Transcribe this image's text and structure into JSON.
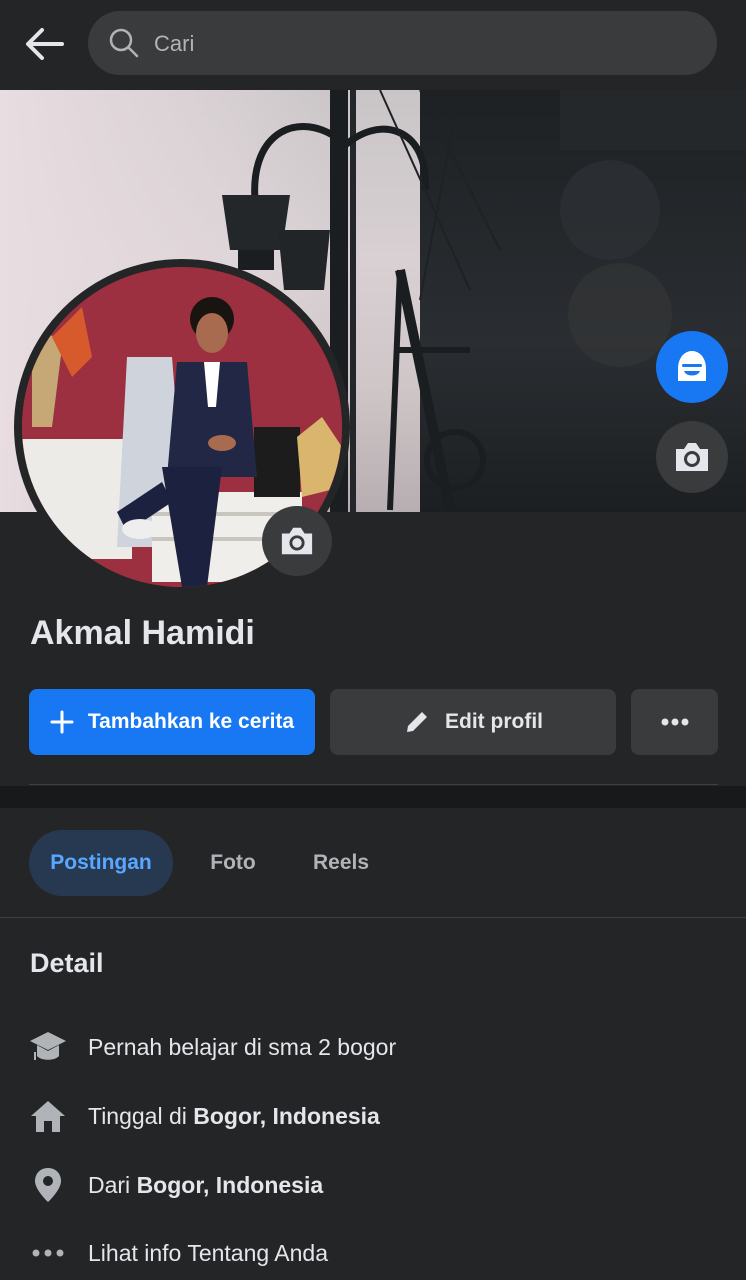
{
  "search": {
    "placeholder": "Cari"
  },
  "profile": {
    "name": "Akmal Hamidi"
  },
  "actions": {
    "add_story_label": "Tambahkan ke cerita",
    "edit_profile_label": "Edit profil"
  },
  "tabs": [
    {
      "label": "Postingan",
      "active": true
    },
    {
      "label": "Foto",
      "active": false
    },
    {
      "label": "Reels",
      "active": false
    }
  ],
  "detail": {
    "title": "Detail",
    "items": [
      {
        "icon": "education-icon",
        "prefix": "Pernah belajar di sma 2 bogor",
        "bold": ""
      },
      {
        "icon": "home-icon",
        "prefix": "Tinggal di ",
        "bold": "Bogor, Indonesia"
      },
      {
        "icon": "location-pin-icon",
        "prefix": "Dari ",
        "bold": "Bogor, Indonesia"
      },
      {
        "icon": "more-dots-icon",
        "prefix": "Lihat info Tentang Anda",
        "bold": ""
      }
    ]
  },
  "colors": {
    "background": "#242526",
    "primary": "#1877f2",
    "secondary_button": "#3a3b3c",
    "active_tab_bg": "#263951",
    "active_tab_text": "#5aa7ff"
  }
}
